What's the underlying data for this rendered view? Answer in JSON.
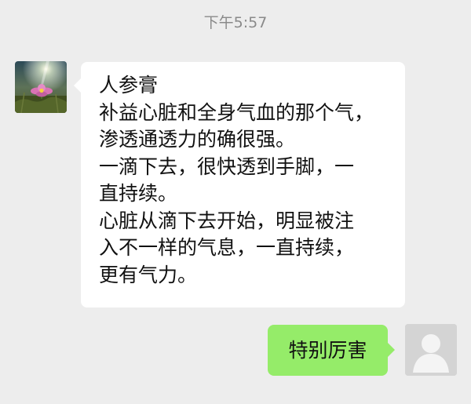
{
  "timestamp": "下午5:57",
  "messages": [
    {
      "side": "received",
      "avatar_icon": "flower-photo-avatar",
      "lines": [
        "人参膏",
        "补益心脏和全身气血的那个气，",
        "渗透通透力的确很强。",
        "一滴下去，很快透到手脚，一",
        "直持续。",
        "心脏从滴下去开始，明显被注",
        "入不一样的气息，一直持续，",
        "更有气力。"
      ]
    },
    {
      "side": "sent",
      "avatar_icon": "default-user-avatar",
      "text": "特别厉害"
    }
  ],
  "colors": {
    "background": "#ededed",
    "received_bubble": "#ffffff",
    "sent_bubble": "#95ec69",
    "timestamp_text": "#8a8a8a"
  }
}
